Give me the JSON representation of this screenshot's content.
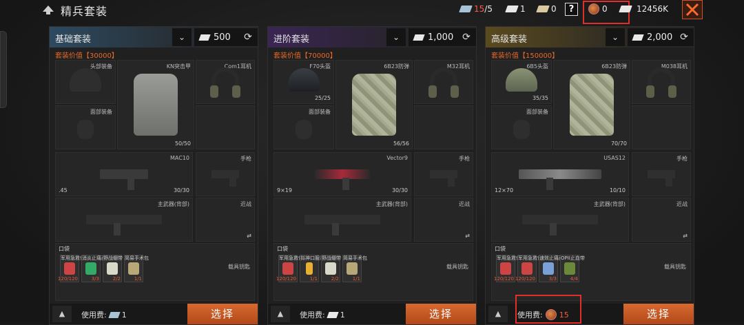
{
  "header": {
    "title": "精兵套装",
    "resources": [
      {
        "icon": "blue-ticket-icon",
        "value": "15",
        "max": "/5"
      },
      {
        "icon": "silver-ticket-icon",
        "value": "1"
      },
      {
        "icon": "paper-ticket-icon",
        "value": "0"
      },
      {
        "icon": "help-icon",
        "value": "?"
      },
      {
        "icon": "medal-icon",
        "value": "0"
      },
      {
        "icon": "cash-icon",
        "value": "12456K"
      }
    ]
  },
  "panels": [
    {
      "title": "基础套装",
      "cost": "500",
      "value": "套装价值【30000】",
      "slots": {
        "head_label": "头部装备",
        "armor_label": "KN突击甲",
        "armor_count": "50/50",
        "ear_label": "Com1耳机",
        "face_label": "面部装备",
        "primary_label": "MAC10",
        "primary_count": "30/30",
        "primary_cal": ".45",
        "pistol_label": "手枪",
        "back_label": "主武器(背部)",
        "melee_label": "近战"
      },
      "pocket_label": "口袋",
      "pocket_items": [
        {
          "name": "军用急救包",
          "count": "120/120"
        },
        {
          "name": "消炎止痛药",
          "count": "3/3"
        },
        {
          "name": "野战绷带",
          "count": "2/2"
        },
        {
          "name": "简易手术包",
          "count": "1/1"
        }
      ],
      "key_label": "载具钥匙",
      "fee_label": "使用费:",
      "fee_value": "1",
      "select_label": "选择"
    },
    {
      "title": "进阶套装",
      "cost": "1,000",
      "value": "套装价值【70000】",
      "slots": {
        "head_label": "F70头盔",
        "head_count": "25/25",
        "armor_label": "6B23防弹",
        "armor_count": "56/56",
        "ear_label": "M32耳机",
        "face_label": "面部装备",
        "primary_label": "Vector9",
        "primary_count": "30/30",
        "primary_cal": "9×19",
        "pistol_label": "手枪",
        "back_label": "主武器(背部)",
        "melee_label": "近战"
      },
      "pocket_label": "口袋",
      "pocket_items": [
        {
          "name": "军用急救包",
          "count": "120/120"
        },
        {
          "name": "拟神口服液",
          "count": "1/1"
        },
        {
          "name": "野战绷带",
          "count": "2/2"
        },
        {
          "name": "简易手术包",
          "count": "1/1"
        }
      ],
      "key_label": "载具钥匙",
      "fee_label": "使用费:",
      "fee_value": "1",
      "select_label": "选择"
    },
    {
      "title": "高级套装",
      "cost": "2,000",
      "value": "套装价值【150000】",
      "slots": {
        "head_label": "6B5头盔",
        "head_count": "35/35",
        "armor_label": "6B23防弹",
        "armor_count": "70/70",
        "ear_label": "M038耳机",
        "face_label": "面部装备",
        "primary_label": "USAS12",
        "primary_count": "10/10",
        "primary_cal": "12×70",
        "pistol_label": "手枪",
        "back_label": "主武器(背部)",
        "melee_label": "近战"
      },
      "pocket_label": "口袋",
      "pocket_items": [
        {
          "name": "军用急救包",
          "count": "120/120"
        },
        {
          "name": "军用急救包",
          "count": "120/120"
        },
        {
          "name": "速效止痛药",
          "count": "3/3"
        },
        {
          "name": "OPII止血带",
          "count": "4/4"
        }
      ],
      "key_label": "载具钥匙",
      "fee_label": "使用费:",
      "fee_value": "15",
      "select_label": "选择"
    }
  ],
  "colors": {
    "accent": "#d76a30",
    "highlight": "#e0302a",
    "value_text": "#e86a2a"
  }
}
